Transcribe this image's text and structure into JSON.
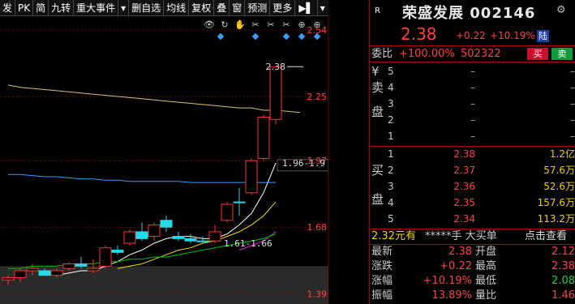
{
  "toolbar": {
    "items": [
      "发",
      "PK",
      "简",
      "九转",
      "重大事件",
      "▾",
      "删自选",
      "均线",
      "复权",
      "叠",
      "窗",
      "预测",
      "更多",
      "▶▌",
      "▾"
    ]
  },
  "chart_data": {
    "type": "candlestick",
    "yaxis_ticks": [
      "2.54",
      "2.25",
      "1.97",
      "1.68",
      "1.39"
    ],
    "yaxis_values": [
      2.54,
      2.25,
      1.97,
      1.68,
      1.39
    ],
    "ylim": [
      1.345,
      2.6
    ],
    "candles": [
      {
        "o": 1.45,
        "h": 1.47,
        "l": 1.43,
        "c": 1.46,
        "up": true
      },
      {
        "o": 1.46,
        "h": 1.5,
        "l": 1.44,
        "c": 1.49,
        "up": true
      },
      {
        "o": 1.49,
        "h": 1.52,
        "l": 1.47,
        "c": 1.5,
        "up": true
      },
      {
        "o": 1.49,
        "h": 1.5,
        "l": 1.47,
        "c": 1.47,
        "up": false
      },
      {
        "o": 1.47,
        "h": 1.5,
        "l": 1.46,
        "c": 1.49,
        "up": true
      },
      {
        "o": 1.5,
        "h": 1.53,
        "l": 1.49,
        "c": 1.52,
        "up": true
      },
      {
        "o": 1.52,
        "h": 1.55,
        "l": 1.5,
        "c": 1.51,
        "up": false
      },
      {
        "o": 1.49,
        "h": 1.54,
        "l": 1.48,
        "c": 1.5,
        "up": true
      },
      {
        "o": 1.51,
        "h": 1.6,
        "l": 1.5,
        "c": 1.59,
        "up": true
      },
      {
        "o": 1.58,
        "h": 1.6,
        "l": 1.56,
        "c": 1.57,
        "up": false
      },
      {
        "o": 1.61,
        "h": 1.67,
        "l": 1.6,
        "c": 1.66,
        "up": true
      },
      {
        "o": 1.66,
        "h": 1.7,
        "l": 1.62,
        "c": 1.63,
        "up": false
      },
      {
        "o": 1.64,
        "h": 1.7,
        "l": 1.62,
        "c": 1.69,
        "up": true
      },
      {
        "o": 1.68,
        "h": 1.73,
        "l": 1.66,
        "c": 1.71,
        "up": false
      },
      {
        "o": 1.64,
        "h": 1.66,
        "l": 1.62,
        "c": 1.63,
        "up": false
      },
      {
        "o": 1.63,
        "h": 1.65,
        "l": 1.61,
        "c": 1.62,
        "up": false
      },
      {
        "o": 1.62,
        "h": 1.64,
        "l": 1.61,
        "c": 1.62,
        "up": false
      },
      {
        "o": 1.62,
        "h": 1.69,
        "l": 1.61,
        "c": 1.66,
        "up": true
      },
      {
        "o": 1.71,
        "h": 1.79,
        "l": 1.7,
        "c": 1.78,
        "up": true
      },
      {
        "o": 1.79,
        "h": 1.85,
        "l": 1.73,
        "c": 1.79,
        "up": false
      },
      {
        "o": 1.83,
        "h": 1.98,
        "l": 1.82,
        "c": 1.97,
        "up": true
      },
      {
        "o": 1.98,
        "h": 2.17,
        "l": 1.97,
        "c": 2.16,
        "up": true
      },
      {
        "o": 2.15,
        "h": 2.38,
        "l": 2.13,
        "c": 2.38,
        "up": true
      }
    ],
    "ma_series": [
      {
        "color": "#ffffff",
        "values": [
          null,
          null,
          null,
          null,
          1.47,
          1.48,
          1.49,
          1.49,
          1.51,
          1.53,
          1.56,
          1.58,
          1.61,
          1.63,
          1.64,
          1.64,
          1.63,
          1.63,
          1.65,
          1.69,
          1.74,
          1.83,
          1.96
        ]
      },
      {
        "color": "#f0e000",
        "values": [
          null,
          null,
          null,
          null,
          null,
          null,
          null,
          null,
          null,
          1.5,
          1.51,
          1.52,
          1.54,
          1.56,
          1.58,
          1.59,
          1.61,
          1.62,
          1.64,
          1.66,
          1.69,
          1.73,
          1.79
        ]
      },
      {
        "color": "#e020e0",
        "values": [
          null,
          null,
          null,
          null,
          null,
          null,
          null,
          null,
          null,
          null,
          null,
          null,
          null,
          null,
          null,
          null,
          null,
          null,
          null,
          1.58,
          1.6,
          1.62,
          1.66
        ]
      },
      {
        "color": "#00c000",
        "values": [
          1.5,
          1.5,
          1.51,
          1.51,
          1.51,
          1.52,
          1.52,
          1.52,
          1.53,
          1.53,
          1.54,
          1.54,
          1.55,
          1.55,
          1.56,
          1.57,
          1.58,
          1.59,
          1.6,
          1.61,
          1.62,
          1.63,
          1.65
        ]
      },
      {
        "color": "#3a9dff",
        "values": [
          1.91,
          1.91,
          1.905,
          1.9,
          1.9,
          1.895,
          1.89,
          1.89,
          1.885,
          1.885,
          1.88,
          1.88,
          1.88,
          1.88,
          1.88,
          1.875,
          1.875,
          1.875,
          1.875,
          1.875,
          1.875,
          1.875,
          1.875
        ]
      },
      {
        "color": "#d8c070",
        "values": [
          2.3,
          2.29,
          2.285,
          2.28,
          2.275,
          2.27,
          2.265,
          2.26,
          2.255,
          2.25,
          2.245,
          2.24,
          2.235,
          2.23,
          2.225,
          2.22,
          2.215,
          2.21,
          2.205,
          2.2,
          2.2,
          2.19,
          2.19
        ]
      }
    ],
    "annotations": {
      "high_label": "2.38",
      "range_top": "1.96-1.9",
      "range_bottom": "1.61-1.66"
    }
  },
  "right_panel": {
    "badge": "R",
    "stock_name": "荣盛发展",
    "stock_code": "002146",
    "price": "2.38",
    "change": "+0.22",
    "change_pct": "+10.19%",
    "board_tag": "陆",
    "ratio_label": "委比",
    "ratio_pct": "+100.00%",
    "ratio_diff": "502322",
    "buy_btn": "买",
    "sell_btn": "卖",
    "sell_side_label": [
      "¥",
      "卖",
      "盘"
    ],
    "sell_rows": [
      {
        "lv": "5",
        "price": "–",
        "vol": "–"
      },
      {
        "lv": "4",
        "price": "–",
        "vol": "–"
      },
      {
        "lv": "3",
        "price": "–",
        "vol": "–"
      },
      {
        "lv": "2",
        "price": "–",
        "vol": "–"
      },
      {
        "lv": "1",
        "price": "–",
        "vol": "–"
      }
    ],
    "buy_side_label": [
      "买",
      "盘"
    ],
    "buy_rows": [
      {
        "lv": "1",
        "price": "2.38",
        "vol": "1.2亿"
      },
      {
        "lv": "2",
        "price": "2.37",
        "vol": "57.6万"
      },
      {
        "lv": "3",
        "price": "2.36",
        "vol": "52.6万"
      },
      {
        "lv": "4",
        "price": "2.35",
        "vol": "157.6万"
      },
      {
        "lv": "5",
        "price": "2.34",
        "vol": "113.2万"
      }
    ],
    "mid_text_a": "2.32元有",
    "mid_text_b": "*****手 大买单",
    "mid_text_c": "点击查看",
    "stats": [
      {
        "l1": "最新",
        "v1": "2.38",
        "l2": "开盘",
        "v2": "2.12",
        "g2": false
      },
      {
        "l1": "涨跌",
        "v1": "+0.22",
        "l2": "最高",
        "v2": "2.38",
        "g2": false
      },
      {
        "l1": "涨幅",
        "v1": "+10.19%",
        "l2": "最低",
        "v2": "2.08",
        "g2": true
      },
      {
        "l1": "振幅",
        "v1": "13.89%",
        "l2": "量比",
        "v2": "1.46",
        "g2": false
      }
    ]
  }
}
